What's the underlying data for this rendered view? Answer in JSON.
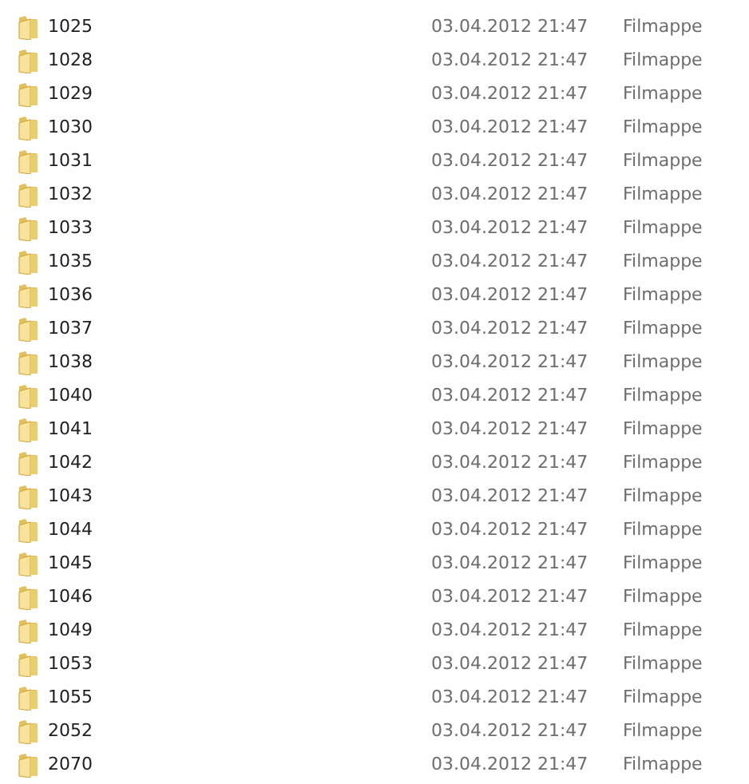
{
  "files": [
    {
      "name": "1025",
      "modified": "03.04.2012 21:47",
      "type": "Filmappe"
    },
    {
      "name": "1028",
      "modified": "03.04.2012 21:47",
      "type": "Filmappe"
    },
    {
      "name": "1029",
      "modified": "03.04.2012 21:47",
      "type": "Filmappe"
    },
    {
      "name": "1030",
      "modified": "03.04.2012 21:47",
      "type": "Filmappe"
    },
    {
      "name": "1031",
      "modified": "03.04.2012 21:47",
      "type": "Filmappe"
    },
    {
      "name": "1032",
      "modified": "03.04.2012 21:47",
      "type": "Filmappe"
    },
    {
      "name": "1033",
      "modified": "03.04.2012 21:47",
      "type": "Filmappe"
    },
    {
      "name": "1035",
      "modified": "03.04.2012 21:47",
      "type": "Filmappe"
    },
    {
      "name": "1036",
      "modified": "03.04.2012 21:47",
      "type": "Filmappe"
    },
    {
      "name": "1037",
      "modified": "03.04.2012 21:47",
      "type": "Filmappe"
    },
    {
      "name": "1038",
      "modified": "03.04.2012 21:47",
      "type": "Filmappe"
    },
    {
      "name": "1040",
      "modified": "03.04.2012 21:47",
      "type": "Filmappe"
    },
    {
      "name": "1041",
      "modified": "03.04.2012 21:47",
      "type": "Filmappe"
    },
    {
      "name": "1042",
      "modified": "03.04.2012 21:47",
      "type": "Filmappe"
    },
    {
      "name": "1043",
      "modified": "03.04.2012 21:47",
      "type": "Filmappe"
    },
    {
      "name": "1044",
      "modified": "03.04.2012 21:47",
      "type": "Filmappe"
    },
    {
      "name": "1045",
      "modified": "03.04.2012 21:47",
      "type": "Filmappe"
    },
    {
      "name": "1046",
      "modified": "03.04.2012 21:47",
      "type": "Filmappe"
    },
    {
      "name": "1049",
      "modified": "03.04.2012 21:47",
      "type": "Filmappe"
    },
    {
      "name": "1053",
      "modified": "03.04.2012 21:47",
      "type": "Filmappe"
    },
    {
      "name": "1055",
      "modified": "03.04.2012 21:47",
      "type": "Filmappe"
    },
    {
      "name": "2052",
      "modified": "03.04.2012 21:47",
      "type": "Filmappe"
    },
    {
      "name": "2070",
      "modified": "03.04.2012 21:47",
      "type": "Filmappe"
    }
  ]
}
